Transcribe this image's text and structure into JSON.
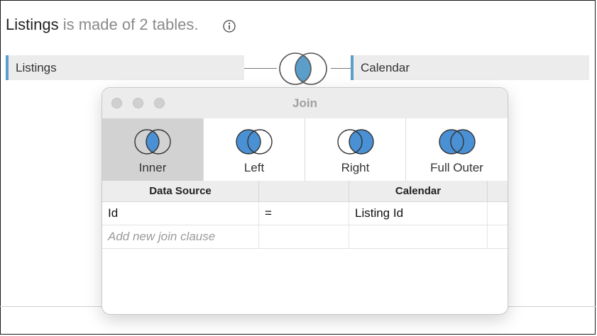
{
  "header": {
    "table_name": "Listings",
    "rest": "is made of 2 tables.",
    "info_icon": "info-circle-icon"
  },
  "canvas": {
    "left_table": "Listings",
    "right_table": "Calendar",
    "join_type_shown": "Inner",
    "accent_color": "#5b9ec9"
  },
  "dialog": {
    "title": "Join",
    "join_types": [
      {
        "label": "Inner",
        "selected": true
      },
      {
        "label": "Left",
        "selected": false
      },
      {
        "label": "Right",
        "selected": false
      },
      {
        "label": "Full Outer",
        "selected": false
      }
    ],
    "columns": {
      "left": "Data Source",
      "operator": "",
      "right": "Calendar"
    },
    "clauses": [
      {
        "left": "Id",
        "operator": "=",
        "right": "Listing Id"
      }
    ],
    "add_clause_placeholder": "Add new join clause",
    "venn_fill_color": "#4a90d4"
  }
}
